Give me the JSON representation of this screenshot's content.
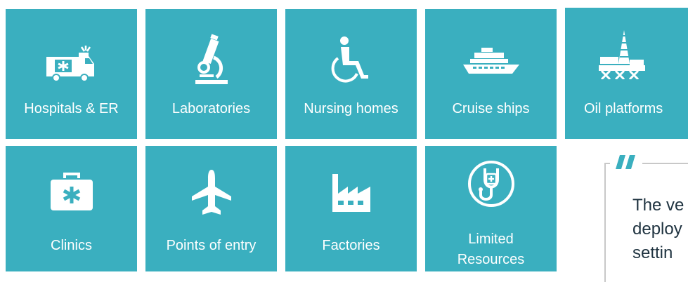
{
  "colors": {
    "tile": "#3aafbf",
    "icon": "#ffffff",
    "quote_mark": "#3aafbf"
  },
  "tiles": [
    {
      "label": "Hospitals & ER",
      "icon": "ambulance-icon"
    },
    {
      "label": "Laboratories",
      "icon": "microscope-icon"
    },
    {
      "label": "Nursing homes",
      "icon": "wheelchair-icon"
    },
    {
      "label": "Cruise ships",
      "icon": "cruise-ship-icon"
    },
    {
      "label": "Oil platforms",
      "icon": "oil-platform-icon"
    },
    {
      "label": "Clinics",
      "icon": "first-aid-kit-icon"
    },
    {
      "label": "Points of entry",
      "icon": "airplane-icon"
    },
    {
      "label": "Factories",
      "icon": "factory-icon"
    },
    {
      "label_line1": "Limited",
      "label_line2": "Resources",
      "icon": "stethoscope-icon"
    }
  ],
  "quote": {
    "icon": "quote-mark-icon",
    "line1": "The ve",
    "line2": "deploy",
    "line3": "settin"
  }
}
